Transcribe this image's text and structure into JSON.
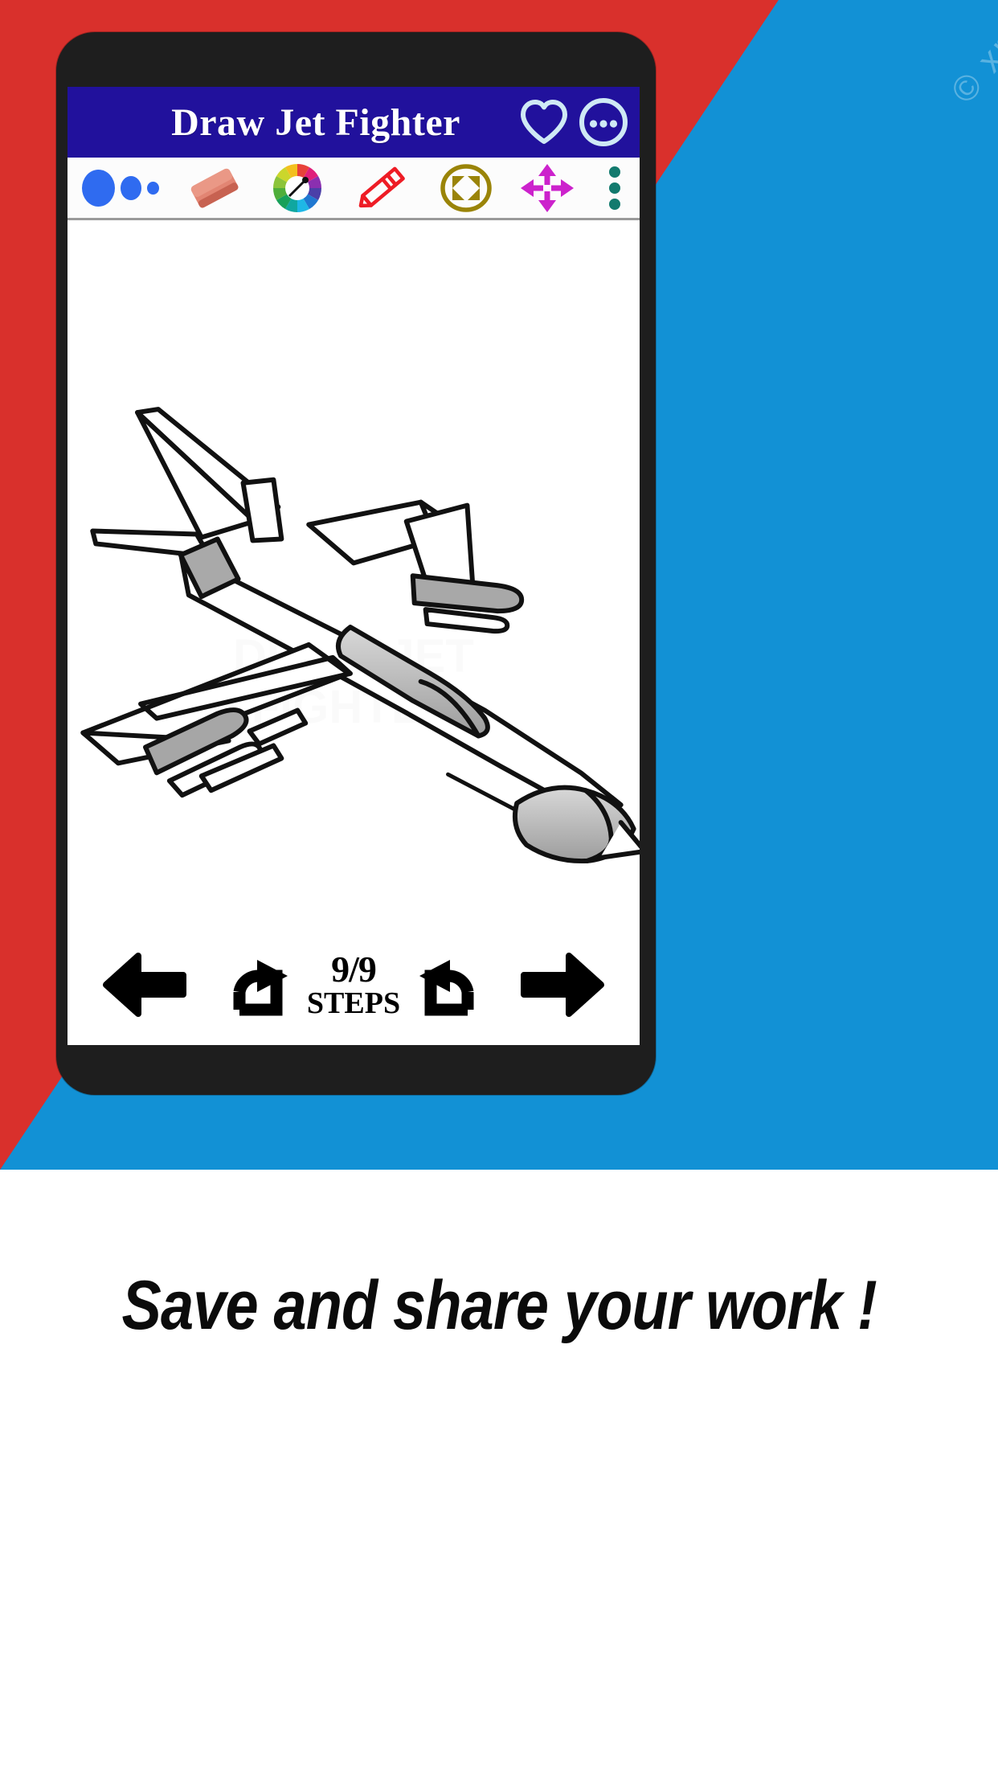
{
  "promo": {
    "background_red": "#d9302c",
    "background_blue": "#1291d5",
    "caption": "Save and share your work !",
    "watermark": "© xm"
  },
  "phone": {
    "bezel_color": "#1e1e1e"
  },
  "app": {
    "title": "Draw Jet Fighter",
    "appbar_color": "#21119c",
    "actions": [
      {
        "name": "favorite-button",
        "icon": "heart-icon",
        "label": "Favorite"
      },
      {
        "name": "overflow-button",
        "icon": "circle-more-icon",
        "label": "More options"
      }
    ]
  },
  "toolbar": {
    "background": "#fcfcfc",
    "tools": [
      {
        "name": "brush-size-tool",
        "icon": "brush-size-icon",
        "label": "Brush size",
        "color": "#2f6bf0"
      },
      {
        "name": "eraser-tool",
        "icon": "eraser-icon",
        "label": "Eraser",
        "color": "#e07b6a"
      },
      {
        "name": "color-palette-tool",
        "icon": "color-wheel-icon",
        "label": "Colors"
      },
      {
        "name": "pencil-tool",
        "icon": "pencil-icon",
        "label": "Pencil",
        "color": "#ee1c25"
      },
      {
        "name": "fit-screen-tool",
        "icon": "fit-screen-icon",
        "label": "Fit to screen",
        "color": "#9a8408"
      },
      {
        "name": "move-tool",
        "icon": "move-arrows-icon",
        "label": "Move",
        "color": "#cc22cc"
      },
      {
        "name": "more-tools-button",
        "icon": "vertical-dots-icon",
        "label": "More",
        "color": "#127a6e"
      }
    ]
  },
  "canvas": {
    "drawing_title": "Jet Fighter line drawing",
    "background": "#ffffff",
    "watermark": "DRAW JET\nFIGHTER"
  },
  "steps": {
    "current": 9,
    "total": 9,
    "counter": "9/9",
    "label": "STEPS",
    "prev_label": "Previous",
    "next_label": "Next",
    "redo_label": "Redo",
    "undo_label": "Undo"
  }
}
